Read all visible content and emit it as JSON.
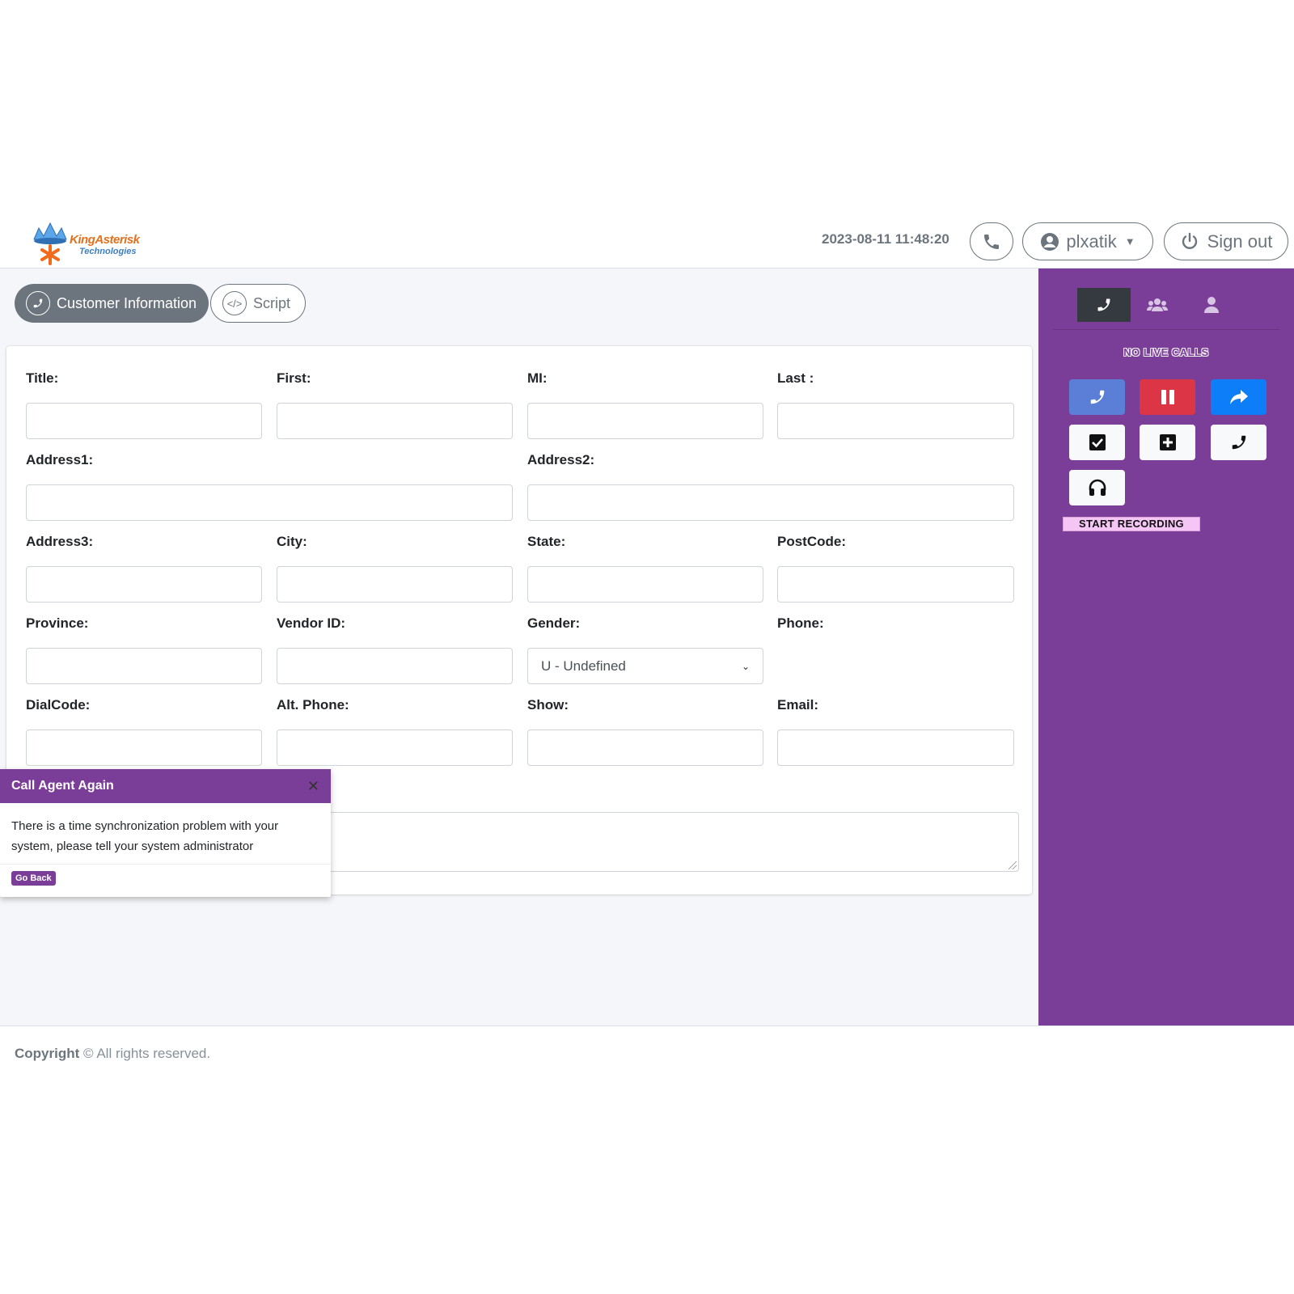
{
  "header": {
    "logo_text": "KingAsterisk",
    "logo_sub": "Technologies",
    "datetime": "2023-08-11 11:48:20",
    "user_label": "plxatik",
    "signout_label": "Sign out"
  },
  "tabs": [
    {
      "label": "Customer Information",
      "active": true,
      "icon": "phone-icon"
    },
    {
      "label": "Script",
      "active": false,
      "icon": "code-icon"
    }
  ],
  "form": {
    "title_label": "Title:",
    "first_label": "First:",
    "mi_label": "MI:",
    "last_label": "Last :",
    "address1_label": "Address1:",
    "address2_label": "Address2:",
    "address3_label": "Address3:",
    "city_label": "City:",
    "state_label": "State:",
    "postcode_label": "PostCode:",
    "province_label": "Province:",
    "vendor_label": "Vendor ID:",
    "gender_label": "Gender:",
    "gender_value": "U - Undefined",
    "phone_label": "Phone:",
    "dialcode_label": "DialCode:",
    "altphone_label": "Alt. Phone:",
    "show_label": "Show:",
    "email_label": "Email:"
  },
  "right_panel": {
    "status": "NO LIVE CALLS",
    "start_recording": "START RECORDING",
    "tab_icons": [
      "phone-icon",
      "users-icon",
      "user-icon"
    ],
    "colors": {
      "panel": "#7b3e98",
      "red": "#dc3545",
      "blue": "#0d7ef7",
      "soft_blue": "#5b7fd6"
    }
  },
  "modal": {
    "title": "Call Agent Again",
    "message": "There is a time synchronization problem with your system, please tell your system administrator",
    "button": "Go Back"
  },
  "footer": {
    "copyright_bold": "Copyright",
    "copyright_rest": "© All rights reserved."
  }
}
